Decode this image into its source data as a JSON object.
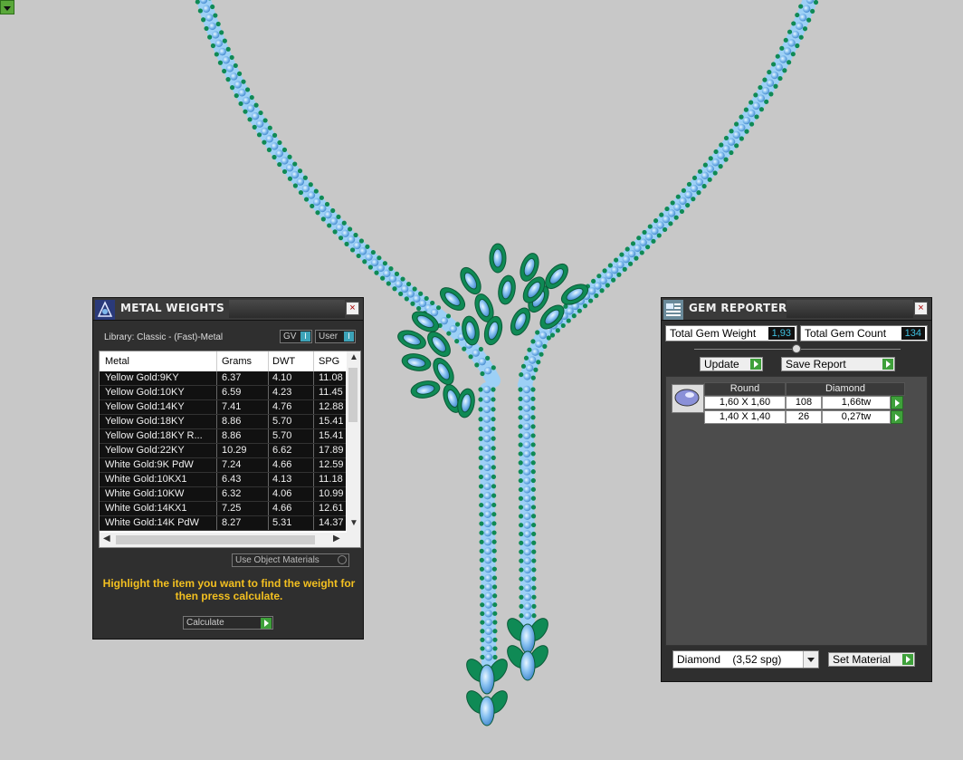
{
  "metal_weights": {
    "title": "METAL WEIGHTS",
    "library_label": "Library: Classic - (Fast)-Metal",
    "toggle_gv": "GV",
    "toggle_user": "User",
    "toggle_mark": "I",
    "columns": [
      "Metal",
      "Grams",
      "DWT",
      "SPG"
    ],
    "rows": [
      [
        "Yellow Gold:9KY",
        "6.37",
        "4.10",
        "11.08"
      ],
      [
        "Yellow Gold:10KY",
        "6.59",
        "4.23",
        "11.45"
      ],
      [
        "Yellow Gold:14KY",
        "7.41",
        "4.76",
        "12.88"
      ],
      [
        "Yellow Gold:18KY",
        "8.86",
        "5.70",
        "15.41"
      ],
      [
        "Yellow Gold:18KY R...",
        "8.86",
        "5.70",
        "15.41"
      ],
      [
        "Yellow Gold:22KY",
        "10.29",
        "6.62",
        "17.89"
      ],
      [
        "White Gold:9K PdW",
        "7.24",
        "4.66",
        "12.59"
      ],
      [
        "White Gold:10KX1",
        "6.43",
        "4.13",
        "11.18"
      ],
      [
        "White Gold:10KW",
        "6.32",
        "4.06",
        "10.99"
      ],
      [
        "White Gold:14KX1",
        "7.25",
        "4.66",
        "12.61"
      ],
      [
        "White Gold:14K PdW",
        "8.27",
        "5.31",
        "14.37"
      ]
    ],
    "use_object_materials": "Use Object Materials",
    "hint": "Highlight the item you want to find the weight for then press calculate.",
    "calculate": "Calculate"
  },
  "gem_reporter": {
    "title": "GEM REPORTER",
    "total_weight_label": "Total Gem Weight",
    "total_weight_value": "1,93",
    "total_count_label": "Total Gem Count",
    "total_count_value": "134",
    "update": "Update",
    "save_report": "Save Report",
    "table": {
      "shape": "Round",
      "material": "Diamond",
      "rows": [
        {
          "size": "1,60 X 1,60",
          "count": "108",
          "weight": "1,66tw"
        },
        {
          "size": "1,40 X 1,40",
          "count": "26",
          "weight": "0,27tw"
        }
      ]
    },
    "material_select": "Diamond    (3,52 spg)",
    "set_material": "Set Material"
  },
  "colors": {
    "viewport_bg": "#c8c8c8",
    "gem_blue": "#7fb8ec",
    "gem_green": "#0f8a55",
    "panel_bg": "#2f2f2f",
    "accent_green": "#3ea03a",
    "hint_yellow": "#f3c020"
  }
}
